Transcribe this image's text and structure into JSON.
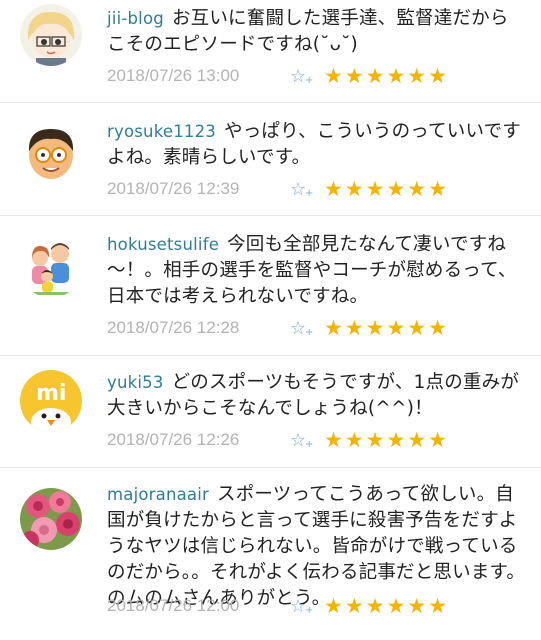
{
  "comments": [
    {
      "user": "jii-blog",
      "text": "お互いに奮闘した選手達、監督達だからこそのエピソードですね(˘ᴗ˘)",
      "time": "2018/07/26 13:00",
      "add_star": "☆",
      "stars": "★★★★★★",
      "avatar": "cartoon-blonde-avatar"
    },
    {
      "user": "ryosuke1123",
      "text": "やっぱり、こういうのっていいですよね。素晴らしいです。",
      "time": "2018/07/26 12:39",
      "add_star": "☆",
      "stars": "★★★★★★",
      "avatar": "cartoon-glasses-avatar"
    },
    {
      "user": "hokusetsulife",
      "text": "今回も全部見たなんて凄いですね～！。相手の選手を監督やコーチが慰めるって、日本では考えられないですね。",
      "time": "2018/07/26 12:28",
      "add_star": "☆",
      "stars": "★★★★★★",
      "avatar": "family-illustration-avatar"
    },
    {
      "user": "yuki53",
      "text": "どのスポーツもそうですが、1点の重みが大きいからこそなんでしょうね(^^)！",
      "time": "2018/07/26 12:26",
      "add_star": "☆",
      "stars": "★★★★★★",
      "avatar": "chick-mi-avatar"
    },
    {
      "user": "majoranaair",
      "text": "スポーツってこうあって欲しい。自国が負けたからと言って選手に殺害予告をだすようなヤツは信じられない。皆命がけで戦っているのだから。。それがよく伝わる記事だと思います。のムのムさんありがとう。",
      "time": "2018/07/26 12:00",
      "add_star": "☆",
      "stars": "★★★★★★",
      "avatar": "pink-roses-avatar"
    }
  ],
  "colors": {
    "username": "#2e7d9a",
    "timestamp": "#b3b3b3",
    "star": "#f5b400",
    "add_star": "#7aaed8"
  }
}
